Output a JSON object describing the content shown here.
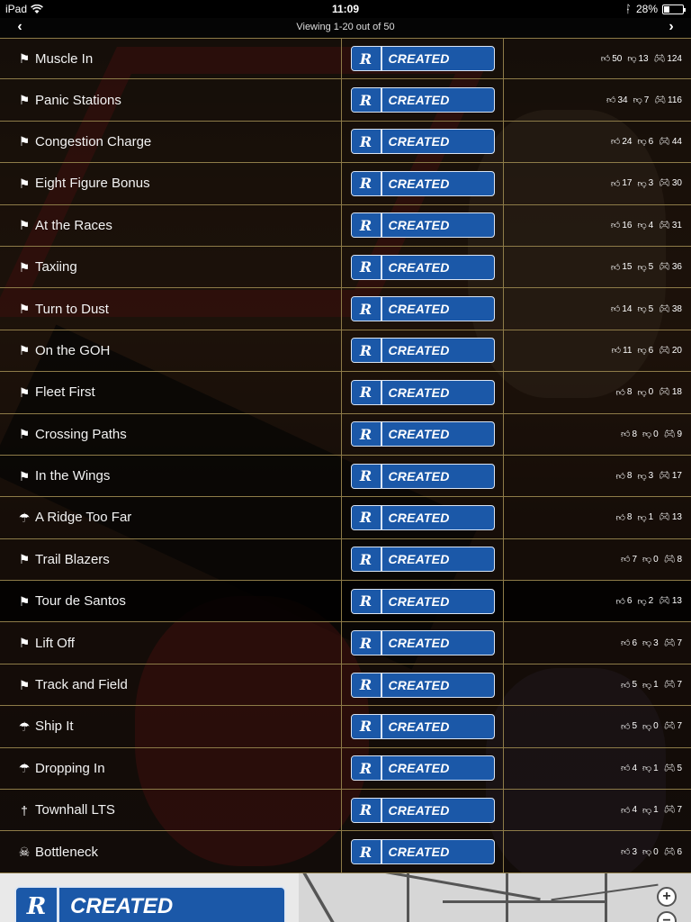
{
  "status_bar": {
    "device": "iPad",
    "time": "11:09",
    "battery": "28%",
    "battery_level": 0.28
  },
  "pager": {
    "prev_icon": "chevron-left-icon",
    "next_icon": "chevron-right-icon",
    "viewing_text": "Viewing 1-20 out of 50"
  },
  "created_label": "CREATED",
  "rockstar_logo_text": "R",
  "rows": [
    {
      "name": "Muscle In",
      "icon": "race-flag",
      "likes": "50",
      "dislikes": "13",
      "plays": "124"
    },
    {
      "name": "Panic Stations",
      "icon": "race-flag",
      "likes": "34",
      "dislikes": "7",
      "plays": "116"
    },
    {
      "name": "Congestion Charge",
      "icon": "race-flag",
      "likes": "24",
      "dislikes": "6",
      "plays": "44"
    },
    {
      "name": "Eight Figure Bonus",
      "icon": "race-flag",
      "likes": "17",
      "dislikes": "3",
      "plays": "30"
    },
    {
      "name": "At the Races",
      "icon": "race-flag",
      "likes": "16",
      "dislikes": "4",
      "plays": "31"
    },
    {
      "name": "Taxiing",
      "icon": "race-flag",
      "likes": "15",
      "dislikes": "5",
      "plays": "36"
    },
    {
      "name": "Turn to Dust",
      "icon": "race-flag",
      "likes": "14",
      "dislikes": "5",
      "plays": "38"
    },
    {
      "name": "On the GOH",
      "icon": "race-flag",
      "likes": "11",
      "dislikes": "6",
      "plays": "20"
    },
    {
      "name": "Fleet First",
      "icon": "race-flag",
      "likes": "8",
      "dislikes": "0",
      "plays": "18"
    },
    {
      "name": "Crossing Paths",
      "icon": "race-flag",
      "likes": "8",
      "dislikes": "0",
      "plays": "9"
    },
    {
      "name": "In the Wings",
      "icon": "race-flag",
      "likes": "8",
      "dislikes": "3",
      "plays": "17"
    },
    {
      "name": "A Ridge Too Far",
      "icon": "parachute",
      "likes": "8",
      "dislikes": "1",
      "plays": "13"
    },
    {
      "name": "Trail Blazers",
      "icon": "race-flag",
      "likes": "7",
      "dislikes": "0",
      "plays": "8"
    },
    {
      "name": "Tour de Santos",
      "icon": "race-flag",
      "likes": "6",
      "dislikes": "2",
      "plays": "13"
    },
    {
      "name": "Lift Off",
      "icon": "race-flag",
      "likes": "6",
      "dislikes": "3",
      "plays": "7"
    },
    {
      "name": "Track and Field",
      "icon": "race-flag",
      "likes": "5",
      "dislikes": "1",
      "plays": "7"
    },
    {
      "name": "Ship It",
      "icon": "parachute",
      "likes": "5",
      "dislikes": "0",
      "plays": "7"
    },
    {
      "name": "Dropping In",
      "icon": "parachute",
      "likes": "4",
      "dislikes": "1",
      "plays": "5"
    },
    {
      "name": "Townhall LTS",
      "icon": "lts",
      "likes": "4",
      "dislikes": "1",
      "plays": "7"
    },
    {
      "name": "Bottleneck",
      "icon": "deathmatch",
      "likes": "3",
      "dislikes": "0",
      "plays": "6"
    }
  ],
  "highlighted_row_index": 13,
  "stat_icons": {
    "likes": "thumbs-up-icon",
    "dislikes": "thumbs-down-icon",
    "plays": "controller-icon"
  },
  "bottom": {
    "created_label": "CREATED",
    "zoom_in_icon": "zoom-in-icon",
    "zoom_out_icon": "zoom-out-icon"
  },
  "colors": {
    "button_blue": "#1b58a8",
    "divider_gold": "#8d7b48"
  }
}
